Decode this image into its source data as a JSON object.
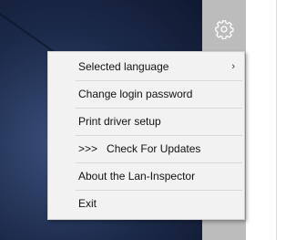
{
  "menu": {
    "items": [
      {
        "label": "Selected language",
        "submenu_arrow": "›"
      },
      {
        "label": "Change login password"
      },
      {
        "label": "Print driver setup"
      },
      {
        "label": ">>>   Check For Updates"
      },
      {
        "label": "About the Lan-Inspector"
      },
      {
        "label": "Exit"
      }
    ]
  },
  "toolbar": {
    "gear_icon": "gear-icon"
  },
  "colors": {
    "menu_bg": "#f2f2f2",
    "side_strip": "#bcbcbc",
    "desktop_dark": "#1c2a4a"
  }
}
